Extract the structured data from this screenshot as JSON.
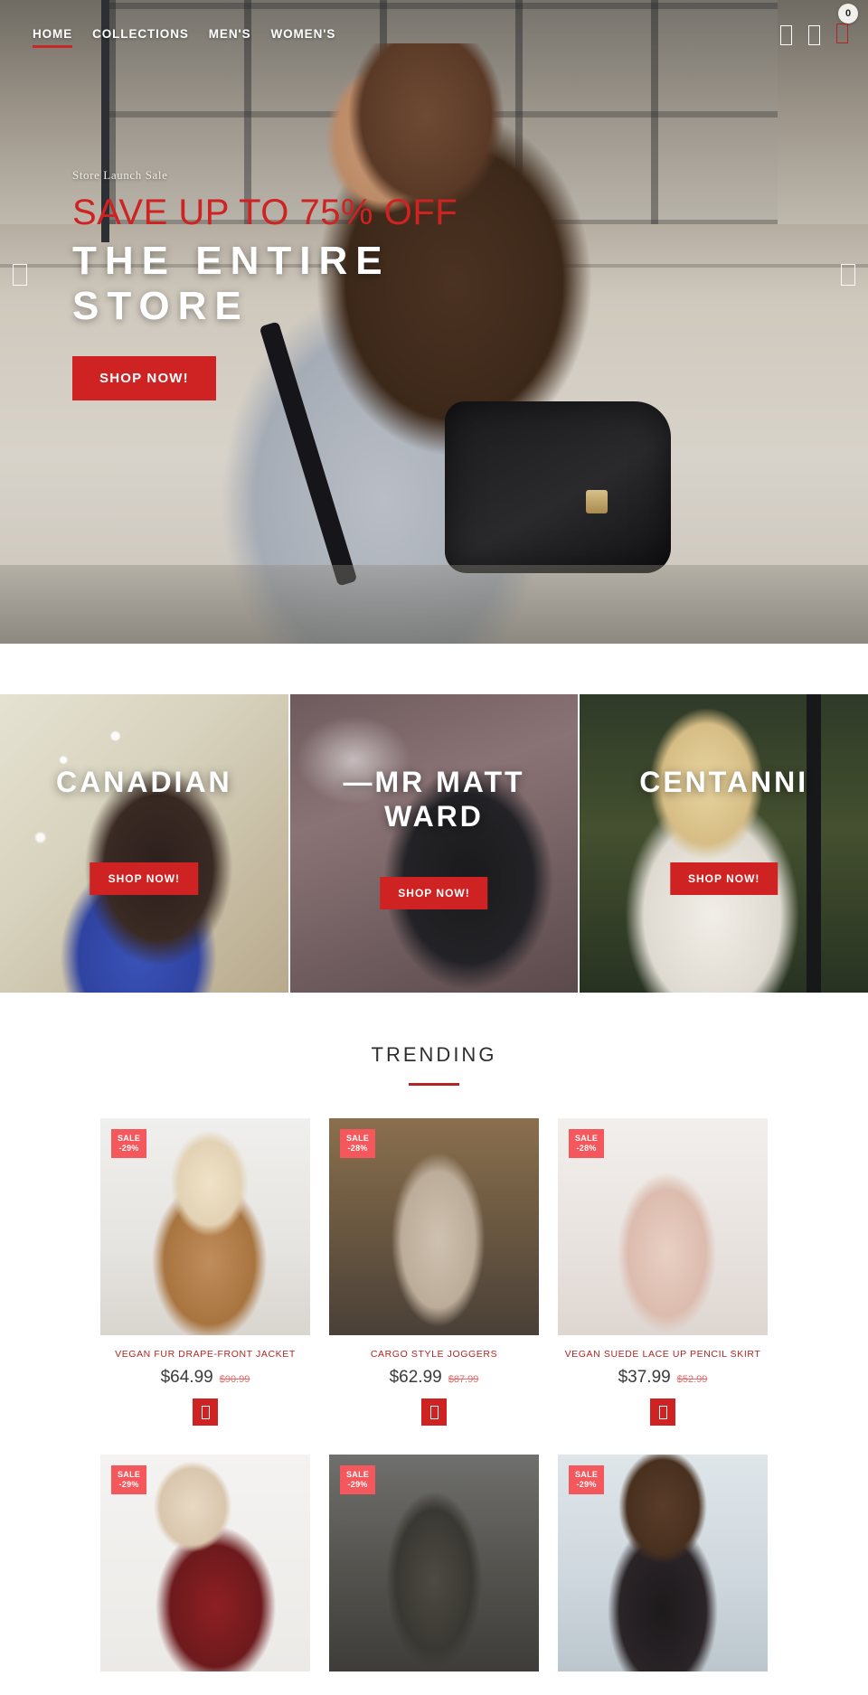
{
  "header": {
    "nav": [
      {
        "label": "HOME",
        "active": true
      },
      {
        "label": "COLLECTIONS",
        "active": false
      },
      {
        "label": "MEN'S",
        "active": false
      },
      {
        "label": "WOMEN'S",
        "active": false
      }
    ],
    "icons": [
      {
        "name": "search-icon",
        "glyph": "search"
      },
      {
        "name": "user-account-icon",
        "glyph": "user"
      },
      {
        "name": "shopping-cart-icon",
        "glyph": "cart"
      }
    ],
    "cart_count": "0",
    "accent_color": "#c62828"
  },
  "hero": {
    "kicker": "Store Launch Sale",
    "sale_line": "SAVE UP TO 75% OFF",
    "big_line": "THE ENTIRE STORE",
    "cta": "SHOP NOW!",
    "prev_label": "prev-slide",
    "next_label": "next-slide",
    "sale_color": "#cf2222"
  },
  "collections": [
    {
      "label": "CANADIAN",
      "cta": "SHOP NOW!"
    },
    {
      "label": "—MR MATT WARD",
      "cta": "SHOP NOW!"
    },
    {
      "label": "CENTANNI",
      "cta": "SHOP NOW!"
    }
  ],
  "trending": {
    "title": "TRENDING",
    "products": [
      {
        "badge_label": "SALE",
        "badge_pct": "-29%",
        "title": "VEGAN FUR DRAPE-FRONT JACKET",
        "price": "$64.99",
        "was": "$90.99"
      },
      {
        "badge_label": "SALE",
        "badge_pct": "-28%",
        "title": "CARGO STYLE JOGGERS",
        "price": "$62.99",
        "was": "$87.99"
      },
      {
        "badge_label": "SALE",
        "badge_pct": "-28%",
        "title": "VEGAN SUEDE LACE UP PENCIL SKIRT",
        "price": "$37.99",
        "was": "$52.99"
      },
      {
        "badge_label": "SALE",
        "badge_pct": "-29%",
        "title": "",
        "price": "",
        "was": ""
      },
      {
        "badge_label": "SALE",
        "badge_pct": "-29%",
        "title": "",
        "price": "",
        "was": ""
      },
      {
        "badge_label": "SALE",
        "badge_pct": "-29%",
        "title": "",
        "price": "",
        "was": ""
      }
    ],
    "add_to_cart_label": "add-to-cart"
  }
}
